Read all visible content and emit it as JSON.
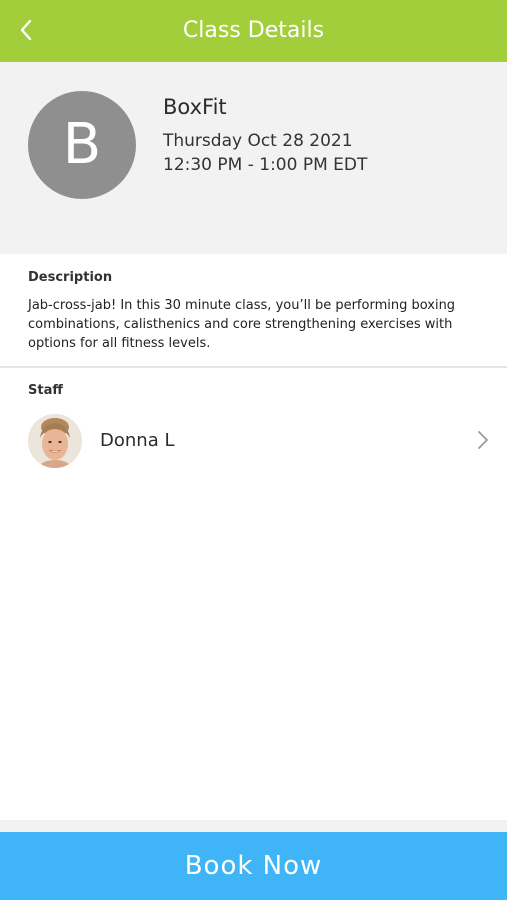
{
  "header": {
    "title": "Class Details",
    "back_icon": "chevron-left-icon"
  },
  "class": {
    "avatar_letter": "B",
    "name": "BoxFit",
    "date": "Thursday Oct 28 2021",
    "time": "12:30 PM - 1:00 PM EDT"
  },
  "description": {
    "heading": "Description",
    "text": "Jab-cross-jab!  In this 30 minute class, you’ll be performing boxing combinations, calisthenics and core strengthening exercises with options for all fitness levels."
  },
  "staff": {
    "heading": "Staff",
    "members": [
      {
        "name": "Donna L"
      }
    ]
  },
  "footer": {
    "book_label": "Book Now"
  },
  "colors": {
    "header_green": "#a3ce3b",
    "book_blue": "#3fb4f7",
    "avatar_gray": "#8f8f8f",
    "summary_bg": "#f2f2f2"
  }
}
